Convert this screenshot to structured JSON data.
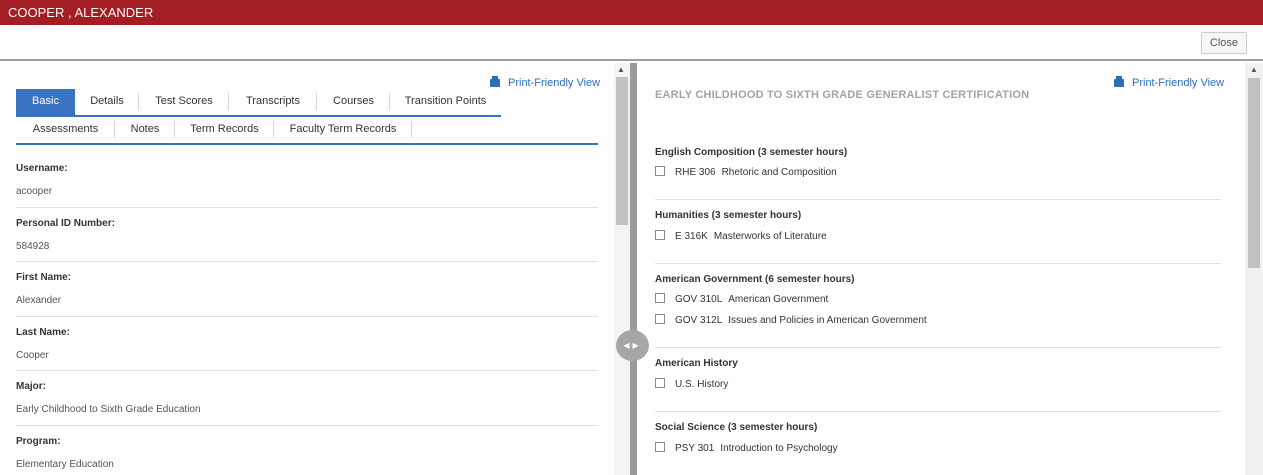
{
  "window": {
    "title": "COOPER , ALEXANDER"
  },
  "toolbar": {
    "close_label": "Close"
  },
  "left": {
    "print_label": "Print-Friendly View",
    "tabs_row1": [
      "Basic",
      "Details",
      "Test Scores",
      "Transcripts",
      "Courses",
      "Transition Points"
    ],
    "tabs_row2": [
      "Assessments",
      "Notes",
      "Term Records",
      "Faculty Term Records"
    ],
    "active_tab": "Basic",
    "fields": [
      {
        "label": "Username:",
        "value": "acooper"
      },
      {
        "label": "Personal ID Number:",
        "value": "584928"
      },
      {
        "label": "First Name:",
        "value": "Alexander"
      },
      {
        "label": "Last Name:",
        "value": "Cooper"
      },
      {
        "label": "Major:",
        "value": "Early Childhood to Sixth Grade Education"
      },
      {
        "label": "Program:",
        "value": "Elementary Education"
      }
    ]
  },
  "right": {
    "print_label": "Print-Friendly View",
    "cert_title": "EARLY CHILDHOOD TO SIXTH GRADE GENERALIST CERTIFICATION",
    "groups": [
      {
        "title": "English Composition (3 semester hours)",
        "courses": [
          {
            "code": "RHE 306",
            "name": "Rhetoric and Composition"
          }
        ]
      },
      {
        "title": "Humanities (3 semester hours)",
        "courses": [
          {
            "code": "E 316K",
            "name": "Masterworks of Literature"
          }
        ]
      },
      {
        "title": "American Government (6 semester hours)",
        "courses": [
          {
            "code": "GOV 310L",
            "name": "American Government"
          },
          {
            "code": "GOV 312L",
            "name": "Issues and Policies in American Government"
          }
        ]
      },
      {
        "title": "American History",
        "courses": [
          {
            "code": "",
            "name": "U.S. History"
          }
        ]
      },
      {
        "title": "Social Science (3 semester hours)",
        "courses": [
          {
            "code": "PSY 301",
            "name": "Introduction to Psychology"
          }
        ]
      }
    ]
  },
  "colors": {
    "titlebar": "#a31e22",
    "accent": "#3b73c3",
    "link": "#2a6ebb"
  },
  "icons": {
    "print": "printer-icon",
    "splitter": "left-right-arrows-icon",
    "scroll_up": "chevron-up-icon"
  }
}
